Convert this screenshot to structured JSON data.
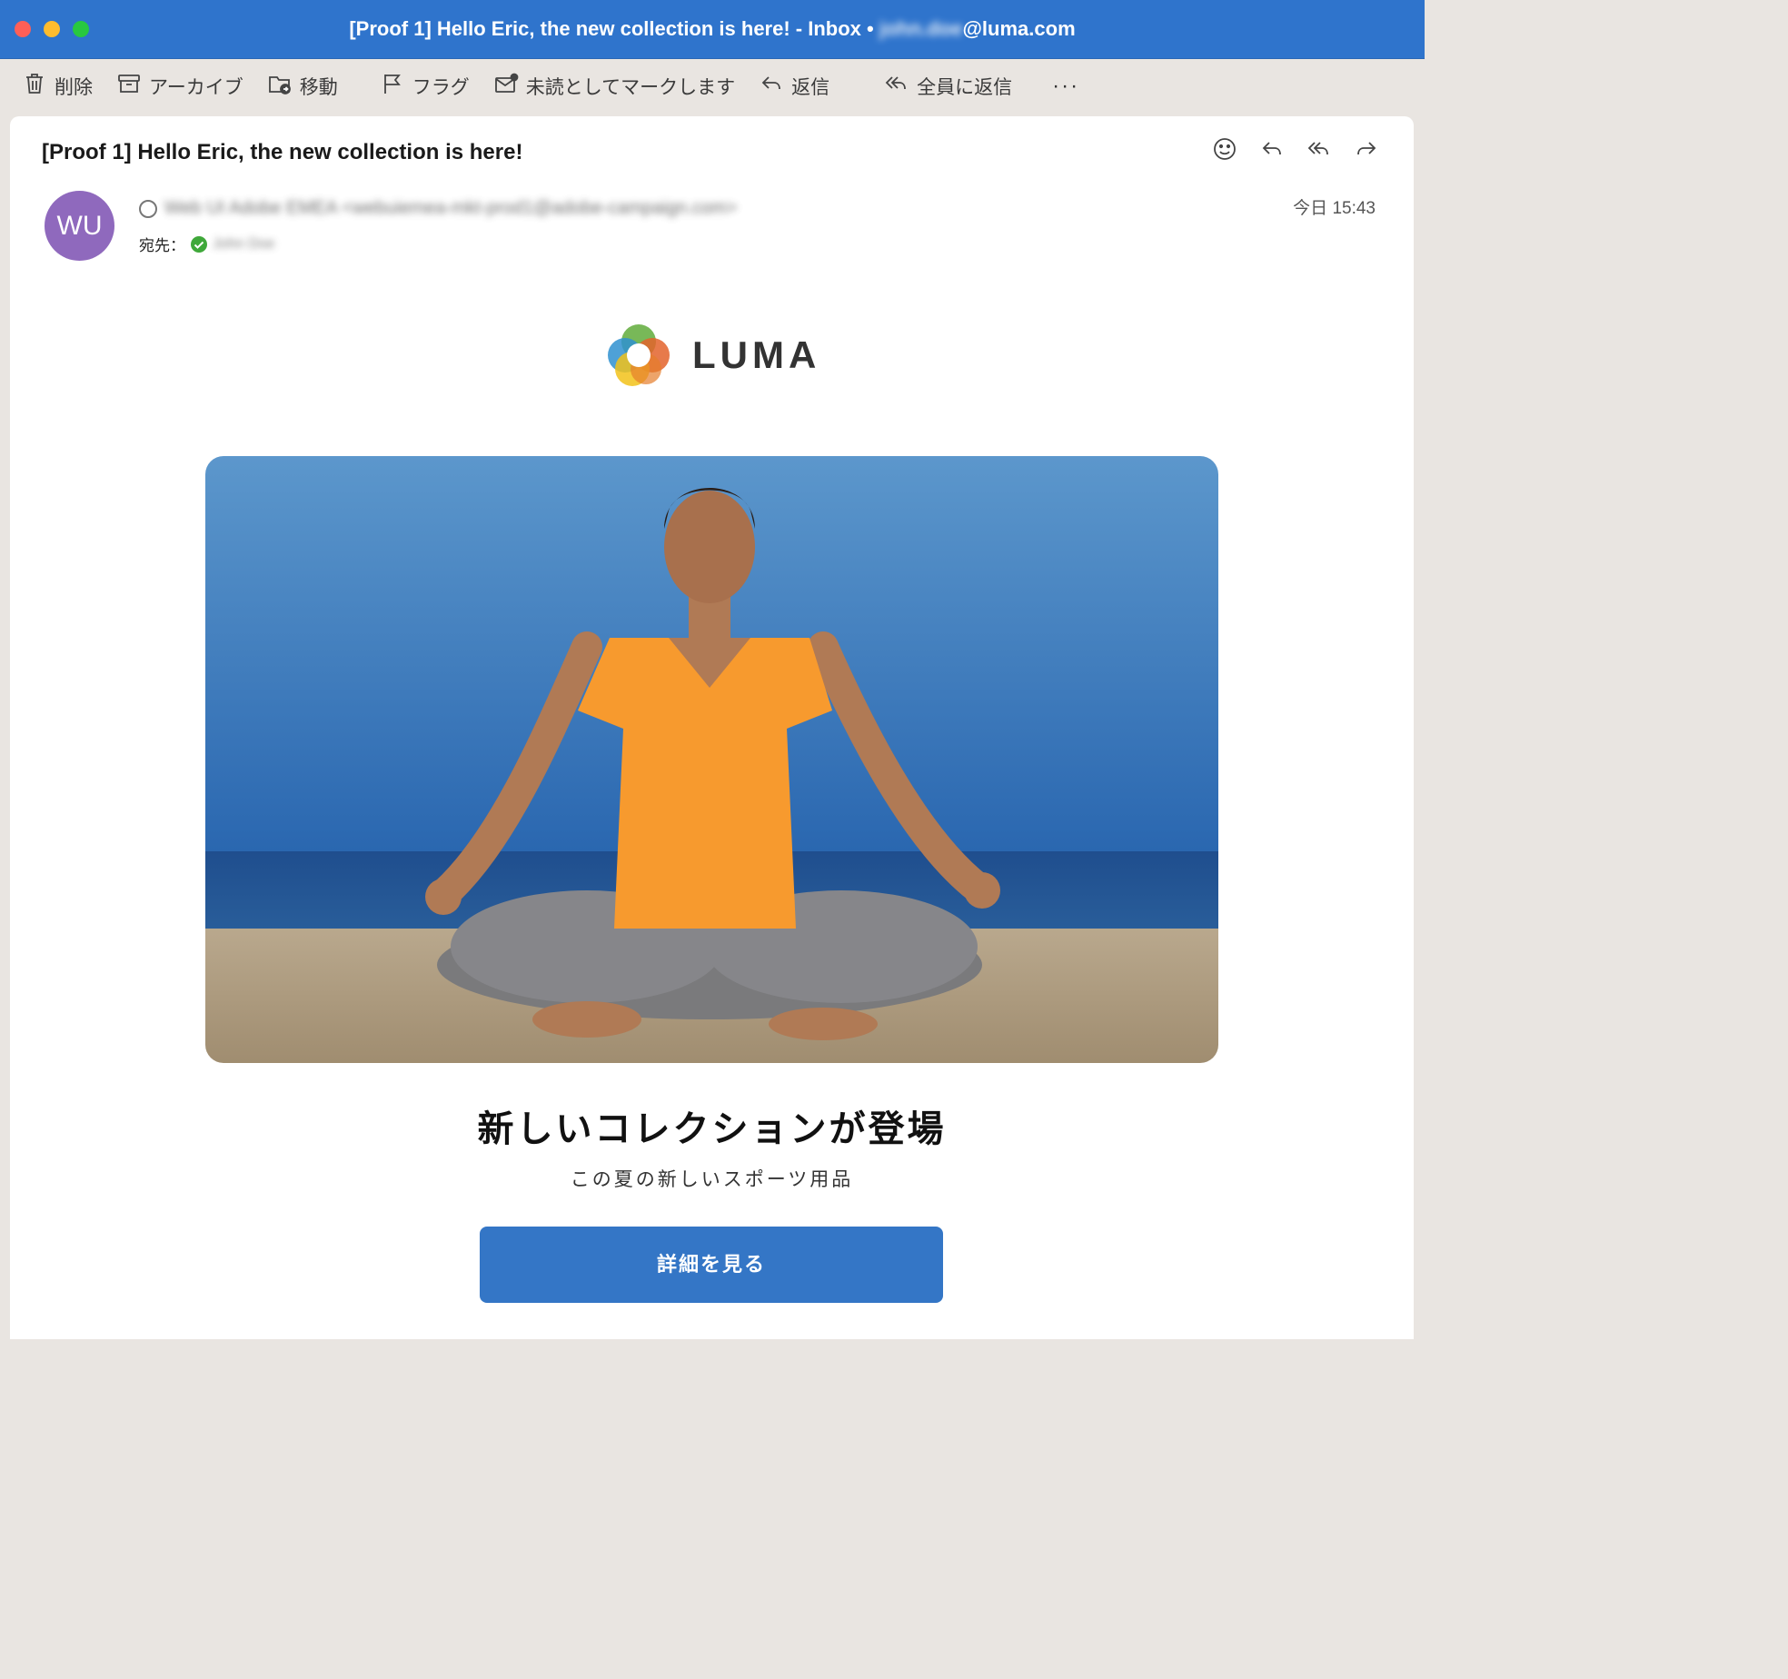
{
  "window": {
    "title_prefix": "[Proof 1] Hello Eric, the new collection is here! - Inbox • ",
    "account_user": "john.doe",
    "account_domain": "@luma.com"
  },
  "toolbar": {
    "delete": "削除",
    "archive": "アーカイブ",
    "move": "移動",
    "flag": "フラグ",
    "mark_unread": "未読としてマークします",
    "reply": "返信",
    "reply_all": "全員に返信",
    "more": "···"
  },
  "message": {
    "subject": "[Proof 1] Hello Eric, the new collection is here!",
    "avatar_initials": "WU",
    "sender": "Web UI Adobe EMEA <webuiemea-mkt-prod1@adobe-campaign.com>",
    "to_label": "宛先：",
    "recipient": "John Doe",
    "time": "今日 15:43"
  },
  "email": {
    "brand": "LUMA",
    "headline": "新しいコレクションが登場",
    "subline": "この夏の新しいスポーツ用品",
    "cta": "詳細を見る"
  },
  "colors": {
    "titlebar": "#2f74cc",
    "avatar": "#8f69bd",
    "cta": "#3476c6",
    "shirt": "#f79a2e"
  },
  "icons": [
    "trash-icon",
    "archive-icon",
    "move-folder-icon",
    "flag-icon",
    "mark-unread-icon",
    "reply-icon",
    "reply-all-icon",
    "more-icon",
    "emoji-icon",
    "forward-icon",
    "check-icon"
  ]
}
